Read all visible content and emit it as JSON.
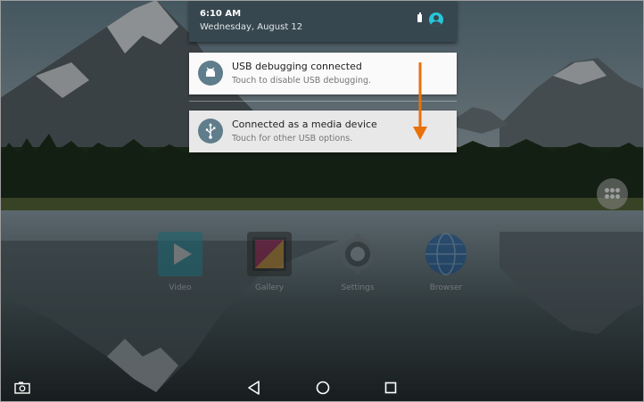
{
  "status_shade": {
    "time": "6:10 AM",
    "date": "Wednesday, August 12"
  },
  "notifications": [
    {
      "title": "USB debugging connected",
      "subtitle": "Touch to disable USB debugging.",
      "icon": "android-bug-icon"
    },
    {
      "title": "Connected as a media device",
      "subtitle": "Touch for other USB options.",
      "icon": "usb-icon"
    }
  ],
  "home_apps": [
    {
      "label": "Video",
      "icon": "video-play-icon"
    },
    {
      "label": "Gallery",
      "icon": "gallery-icon"
    },
    {
      "label": "Settings",
      "icon": "settings-gear-icon"
    },
    {
      "label": "Browser",
      "icon": "globe-icon"
    }
  ],
  "nav_bar": {
    "buttons": [
      "back",
      "home",
      "recents"
    ]
  },
  "colors": {
    "shade_bg": "#37474f",
    "accent_arrow": "#e8710a",
    "user_avatar": "#26c6da",
    "notification_icon_bg": "#607d8b"
  }
}
